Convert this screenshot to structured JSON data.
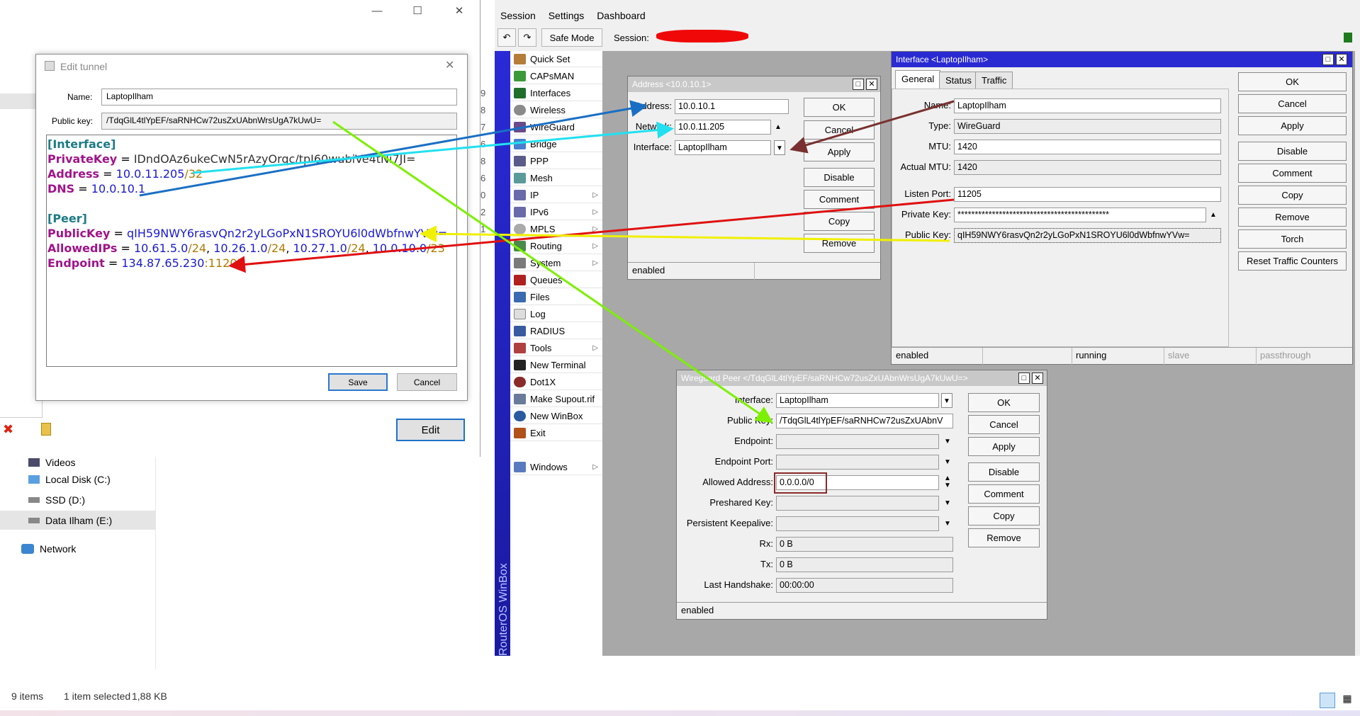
{
  "explorer": {
    "nav": [
      "Videos",
      "Local Disk (C:)",
      "SSD (D:)",
      "Data Ilham (E:)",
      "Network"
    ],
    "status_items": "9 items",
    "status_selected": "1 item selected",
    "status_size": "1,88 KB",
    "edit_button": "Edit",
    "right_digits": [
      "9",
      "8",
      "7",
      "6",
      "8",
      "6",
      "0",
      "2",
      "1"
    ]
  },
  "edit_tunnel": {
    "title": "Edit tunnel",
    "name_label": "Name:",
    "name_value": "LaptopIlham",
    "pubkey_label": "Public key:",
    "pubkey_value": "/TdqGlL4tlYpEF/saRNHCw72usZxUAbnWrsUgA7kUwU=",
    "config": {
      "interface_section": "[Interface]",
      "privatekey_key": "PrivateKey",
      "privatekey_value": "IDndOAz6ukeCwN5rAzyOrqc/tpI60wubiVe4tNi7JI=",
      "address_key": "Address",
      "address_ip": "10.0.11.205",
      "address_mask": "32",
      "dns_key": "DNS",
      "dns_value": "10.0.10.1",
      "peer_section": "[Peer]",
      "publickey_key": "PublicKey",
      "publickey_value": "qIH59NWY6rasvQn2r2yLGoPxN1SROYU6l0dWbfnwYVw=",
      "allowedips_key": "AllowedIPs",
      "aip1": "10.61.5.0",
      "aip2": "10.26.1.0",
      "aip3": "10.27.1.0",
      "aip4": "10.0.10.0",
      "mask24": "24",
      "mask23": "23",
      "endpoint_key": "Endpoint",
      "endpoint_ip": "134.87.65.230",
      "endpoint_port": "11205",
      "eq": "=",
      "slash": "/",
      "comma": ", ",
      "colon": ":"
    },
    "save": "Save",
    "cancel": "Cancel"
  },
  "winbox": {
    "menu": [
      "Session",
      "Settings",
      "Dashboard"
    ],
    "safe_mode": "Safe Mode",
    "session_label": "Session:",
    "vertical_brand": "RouterOS WinBox",
    "sidebar": [
      "Quick Set",
      "CAPsMAN",
      "Interfaces",
      "Wireless",
      "WireGuard",
      "Bridge",
      "PPP",
      "Mesh",
      "IP",
      "IPv6",
      "MPLS",
      "Routing",
      "System",
      "Queues",
      "Files",
      "Log",
      "RADIUS",
      "Tools",
      "New Terminal",
      "Dot1X",
      "Make Supout.rif",
      "New WinBox",
      "Exit",
      "Windows"
    ]
  },
  "address_dlg": {
    "title": "Address <10.0.10.1>",
    "address_label": "Address:",
    "address_value": "10.0.10.1",
    "network_label": "Network:",
    "network_value": "10.0.11.205",
    "interface_label": "Interface:",
    "interface_value": "LaptopIlham",
    "buttons": [
      "OK",
      "Cancel",
      "Apply",
      "Disable",
      "Comment",
      "Copy",
      "Remove"
    ],
    "status": "enabled"
  },
  "iface_dlg": {
    "title": "Interface <LaptopIlham>",
    "tabs": [
      "General",
      "Status",
      "Traffic"
    ],
    "name_label": "Name:",
    "name_value": "LaptopIlham",
    "type_label": "Type:",
    "type_value": "WireGuard",
    "mtu_label": "MTU:",
    "mtu_value": "1420",
    "amtu_label": "Actual MTU:",
    "amtu_value": "1420",
    "port_label": "Listen Port:",
    "port_value": "11205",
    "privkey_label": "Private Key:",
    "privkey_value": "********************************************",
    "pubkey_label": "Public Key:",
    "pubkey_value": "qIH59NWY6rasvQn2r2yLGoPxN1SROYU6l0dWbfnwYVw=",
    "buttons": [
      "OK",
      "Cancel",
      "Apply",
      "Disable",
      "Comment",
      "Copy",
      "Remove",
      "Torch",
      "Reset Traffic Counters"
    ],
    "status": [
      "enabled",
      "running",
      "slave",
      "passthrough"
    ]
  },
  "peer_dlg": {
    "title": "Wireguard Peer </TdqGlL4tlYpEF/saRNHCw72usZxUAbnWrsUgA7kUwU=>",
    "interface_label": "Interface:",
    "interface_value": "LaptopIlham",
    "pubkey_label": "Public Key:",
    "pubkey_value": "/TdqGlL4tlYpEF/saRNHCw72usZxUAbnV",
    "endpoint_label": "Endpoint:",
    "endpoint_port_label": "Endpoint Port:",
    "allowed_label": "Allowed Address:",
    "allowed_value": "0.0.0.0/0",
    "psk_label": "Preshared Key:",
    "keepalive_label": "Persistent Keepalive:",
    "rx_label": "Rx:",
    "rx_value": "0 B",
    "tx_label": "Tx:",
    "tx_value": "0 B",
    "hs_label": "Last Handshake:",
    "hs_value": "00:00:00",
    "buttons": [
      "OK",
      "Cancel",
      "Apply",
      "Disable",
      "Comment",
      "Copy",
      "Remove"
    ],
    "status": "enabled"
  },
  "colors": {
    "arrow_blue": "#1a6fc4",
    "arrow_cyan": "#22e0f0",
    "arrow_brown": "#7a3030",
    "arrow_red": "#e01010",
    "arrow_yellow": "#f0f000",
    "arrow_green": "#7cf000",
    "highlight_box": "#8b2a2a"
  }
}
